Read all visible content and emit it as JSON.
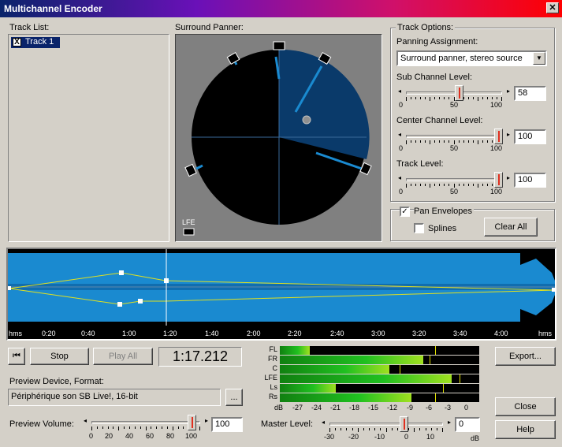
{
  "window": {
    "title": "Multichannel Encoder",
    "close": "✕"
  },
  "track_list": {
    "label": "Track List:",
    "items": [
      {
        "label": "Track 1",
        "checked": "X"
      }
    ]
  },
  "panner": {
    "label": "Surround Panner:",
    "lfe": "LFE"
  },
  "track_options": {
    "label": "Track Options:",
    "panning_label": "Panning Assignment:",
    "panning_value": "Surround panner, stereo source",
    "sub_label": "Sub Channel Level:",
    "sub_value": "58",
    "sub_level": 0.58,
    "center_label": "Center Channel Level:",
    "center_value": "100",
    "center_level": 1.0,
    "track_label": "Track Level:",
    "track_value": "100",
    "track_level": 1.0,
    "scale": [
      "0",
      "50",
      "100"
    ]
  },
  "envelopes": {
    "pan_label": "Pan Envelopes",
    "pan_checked": "✓",
    "splines_label": "Splines",
    "clear_all": "Clear All"
  },
  "ruler": [
    "hms",
    "0:20",
    "0:40",
    "1:00",
    "1:20",
    "1:40",
    "2:00",
    "2:20",
    "2:40",
    "3:00",
    "3:20",
    "3:40",
    "4:00",
    "hms"
  ],
  "transport": {
    "prev": "⏮",
    "stop": "Stop",
    "play_all": "Play All",
    "time": "1:17.212"
  },
  "preview": {
    "device_label": "Preview Device, Format:",
    "device_value": "Périphérique son SB Live!, 16-bit",
    "browse": "...",
    "volume_label": "Preview Volume:",
    "volume_value": "100",
    "volume_level": 1.0,
    "volume_scale": [
      "0",
      "20",
      "40",
      "60",
      "80",
      "100"
    ]
  },
  "meters": {
    "channels": [
      {
        "name": "FL",
        "level": 0.15,
        "peak": 0.78
      },
      {
        "name": "FR",
        "level": 0.72,
        "peak": 0.75
      },
      {
        "name": "C",
        "level": 0.55,
        "peak": 0.6
      },
      {
        "name": "LFE",
        "level": 0.86,
        "peak": 0.9
      },
      {
        "name": "Ls",
        "level": 0.28,
        "peak": 0.82
      },
      {
        "name": "Rs",
        "level": 0.66,
        "peak": 0.78
      }
    ],
    "scale": [
      "dB",
      "-27",
      "-24",
      "-21",
      "-18",
      "-15",
      "-12",
      "-9",
      "-6",
      "-3",
      "0"
    ]
  },
  "master": {
    "label": "Master Level:",
    "value": "0",
    "unit": "dB",
    "level": 0.0,
    "scale": [
      "-30",
      "-20",
      "-10",
      "0",
      "10"
    ]
  },
  "buttons": {
    "export": "Export...",
    "close": "Close",
    "help": "Help"
  }
}
